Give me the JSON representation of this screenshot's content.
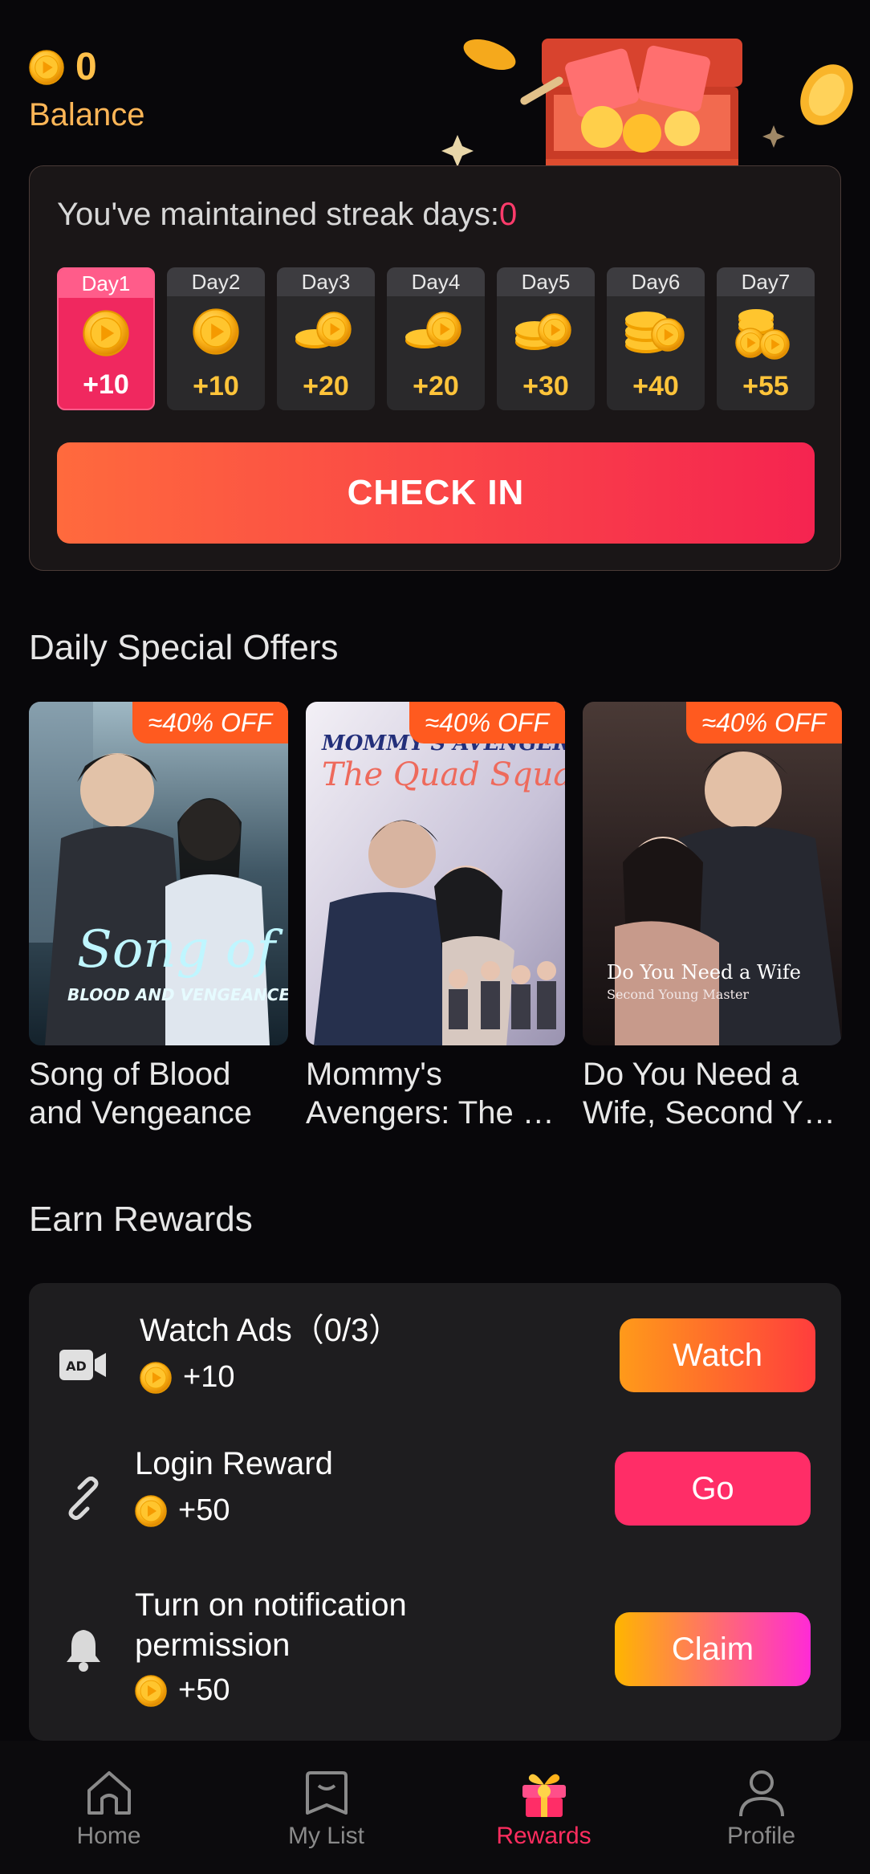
{
  "header": {
    "balance_value": "0",
    "balance_label": "Balance"
  },
  "streak": {
    "prefix": "You've maintained streak days:",
    "count": "0",
    "days": [
      {
        "label": "Day1",
        "amount": "+10",
        "icon": "coin-single-icon",
        "active": true
      },
      {
        "label": "Day2",
        "amount": "+10",
        "icon": "coin-single-icon",
        "active": false
      },
      {
        "label": "Day3",
        "amount": "+20",
        "icon": "coin-pair-icon",
        "active": false
      },
      {
        "label": "Day4",
        "amount": "+20",
        "icon": "coin-pair-icon",
        "active": false
      },
      {
        "label": "Day5",
        "amount": "+30",
        "icon": "coin-pair-icon",
        "active": false
      },
      {
        "label": "Day6",
        "amount": "+40",
        "icon": "coin-stack-icon",
        "active": false
      },
      {
        "label": "Day7",
        "amount": "+55",
        "icon": "coin-pile-icon",
        "active": false
      }
    ],
    "checkin_label": "CHECK IN"
  },
  "offers": {
    "title": "Daily Special Offers",
    "items": [
      {
        "discount": "≈40% OFF",
        "title": "Song of Blood and Vengeance",
        "poster_title": "Song of",
        "poster_subtitle": "BLOOD AND VENGEANCE"
      },
      {
        "discount": "≈40% OFF",
        "title": "Mommy's Avengers: The …",
        "poster_title": "MOMMY'S AVENGERS",
        "poster_subtitle": "The Quad Squad"
      },
      {
        "discount": "≈40% OFF",
        "title": "Do You Need a Wife, Second Y…",
        "poster_title": "Do You Need a Wife",
        "poster_subtitle": "Second Young Master"
      }
    ]
  },
  "rewards": {
    "title": "Earn Rewards",
    "tasks": [
      {
        "title": "Watch Ads（0/3）",
        "reward": "+10",
        "button": "Watch",
        "icon": "ad-video-icon"
      },
      {
        "title": "Login Reward",
        "reward": "+50",
        "button": "Go",
        "icon": "link-icon"
      },
      {
        "title": "Turn on notification permission",
        "reward": "+50",
        "button": "Claim",
        "icon": "bell-icon"
      }
    ]
  },
  "nav": {
    "items": [
      {
        "label": "Home",
        "icon": "home-icon"
      },
      {
        "label": "My List",
        "icon": "bookmark-icon"
      },
      {
        "label": "Rewards",
        "icon": "gift-icon",
        "active": true
      },
      {
        "label": "Profile",
        "icon": "profile-icon"
      }
    ]
  },
  "colors": {
    "accent_pink": "#ff2d5f",
    "coin_gold": "#ffc43a",
    "background": "#08070a"
  }
}
